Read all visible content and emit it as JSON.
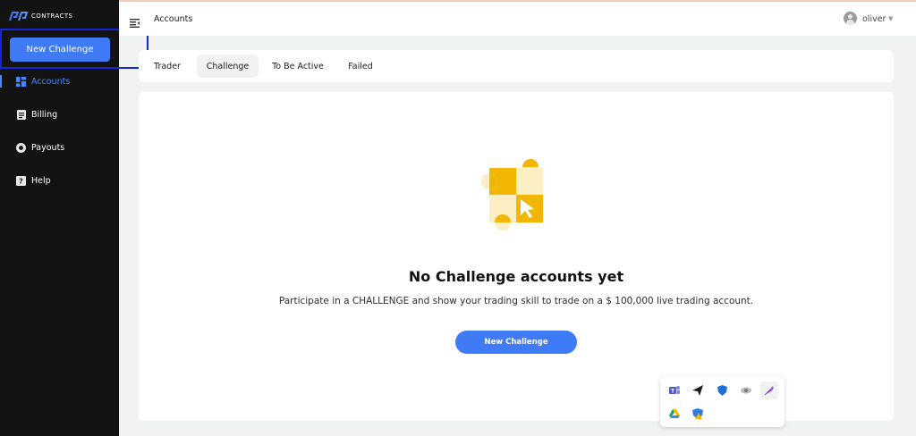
{
  "brand": {
    "logo_text": "CONTRACTS"
  },
  "sidebar": {
    "new_challenge_label": "New Challenge",
    "items": [
      {
        "label": "Accounts",
        "icon": "grid-icon",
        "active": true
      },
      {
        "label": "Billing",
        "icon": "document-icon",
        "active": false
      },
      {
        "label": "Payouts",
        "icon": "coin-icon",
        "active": false
      },
      {
        "label": "Help",
        "icon": "question-icon",
        "active": false
      }
    ]
  },
  "header": {
    "title": "Accounts",
    "user_name": "oliver"
  },
  "tabs": [
    {
      "label": "Trader",
      "active": false
    },
    {
      "label": "Challenge",
      "active": true
    },
    {
      "label": "To Be Active",
      "active": false
    },
    {
      "label": "Failed",
      "active": false
    }
  ],
  "empty_state": {
    "title": "No Challenge accounts yet",
    "description": "Participate in a CHALLENGE and show your trading skill to trade on a $ 100,000 live trading account.",
    "button_label": "New Challenge"
  },
  "tray_icons": [
    "teams-icon",
    "send-icon",
    "shield-icon",
    "eye-icon",
    "feather-icon",
    "drive-icon",
    "shield-warning-icon"
  ],
  "colors": {
    "accent": "#3f7bf7",
    "sidebar_bg": "#131313",
    "illustration_yellow": "#f2b705",
    "illustration_light": "#fdefc4"
  }
}
